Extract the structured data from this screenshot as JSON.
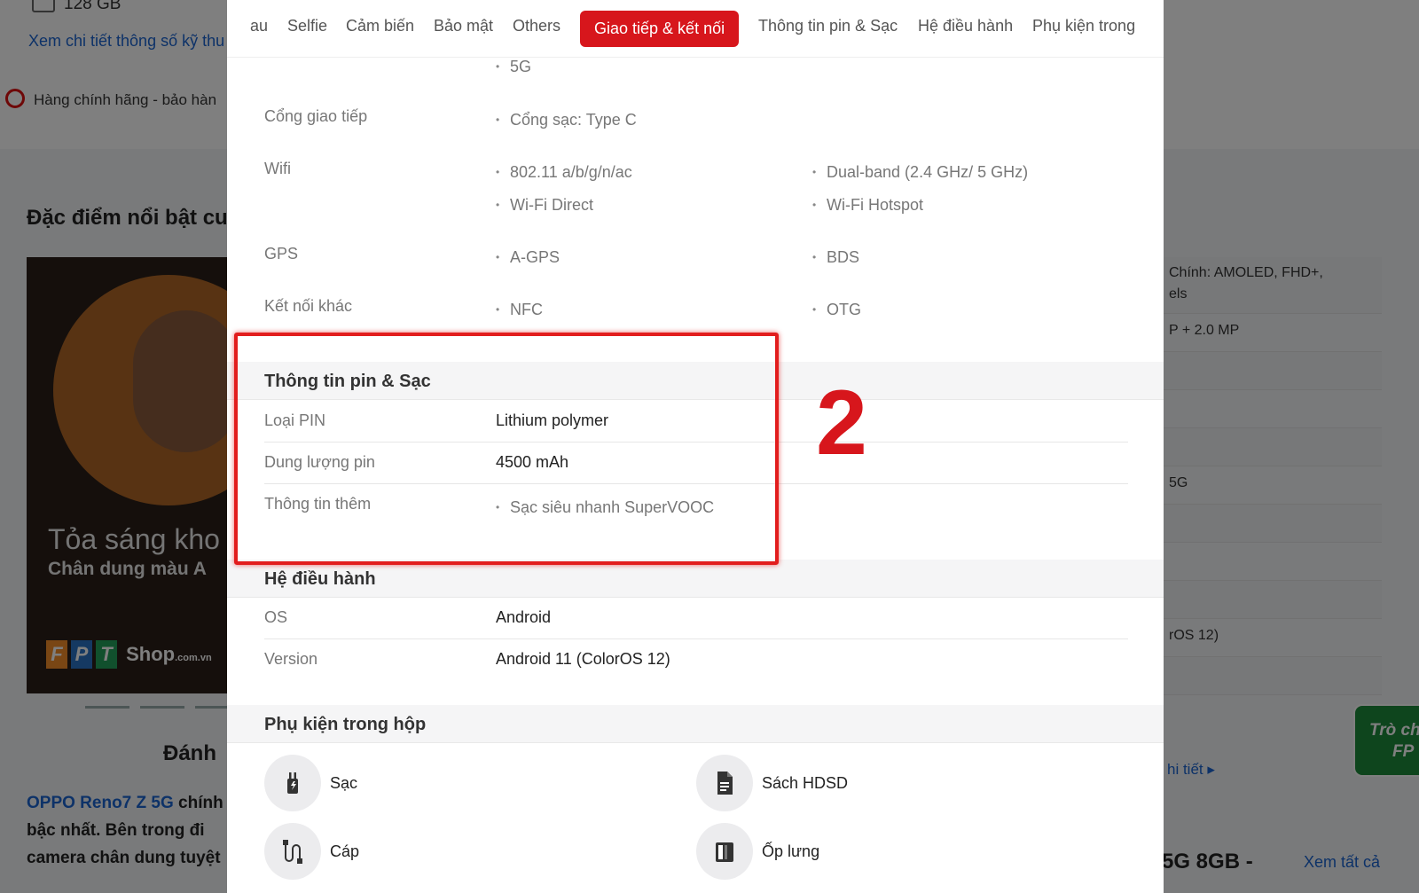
{
  "background": {
    "storage": "128 GB",
    "spec_link": "Xem chi tiết thông số kỹ thu",
    "genuine": "Hàng chính hãng - bảo hàn",
    "feature_title": "Đặc điểm nổi bật cu",
    "photo_caption_1": "Tỏa sáng kho",
    "photo_caption_2": "Chân dung màu A",
    "brand": "Shop",
    "brand_suffix": ".com.vn",
    "review_title": "Đánh",
    "article_link": "OPPO Reno7 Z 5G",
    "article_text_1": "chính",
    "article_text_2": "bậc nhất. Bên trong đi",
    "article_text_3": "camera chân dung tuyệt",
    "right_rows": [
      "Chính: AMOLED, FHD+,",
      "els",
      "P + 2.0 MP",
      "",
      "",
      "",
      "5G",
      "",
      "",
      "",
      "rOS 12)",
      ""
    ],
    "detail_link": "hi tiết",
    "bottom_title": "5G 8GB -",
    "see_all": "Xem tất cả",
    "game_badge_1": "Trò ch",
    "game_badge_2": "FP"
  },
  "tabs": [
    {
      "label": "au"
    },
    {
      "label": "Selfie"
    },
    {
      "label": "Cảm biến"
    },
    {
      "label": "Bảo mật"
    },
    {
      "label": "Others"
    },
    {
      "label": "Giao tiếp & kết nối",
      "active": true
    },
    {
      "label": "Thông tin pin & Sạc"
    },
    {
      "label": "Hệ điều hành"
    },
    {
      "label": "Phụ kiện trong"
    }
  ],
  "connectivity": {
    "top_value": "5G",
    "port_label": "Cổng giao tiếp",
    "port_value": "Cổng sạc: Type C",
    "wifi_label": "Wifi",
    "wifi_values": [
      "802.11 a/b/g/n/ac",
      "Dual-band (2.4 GHz/ 5 GHz)",
      "Wi-Fi Direct",
      "Wi-Fi Hotspot"
    ],
    "gps_label": "GPS",
    "gps_values": [
      "A-GPS",
      "BDS"
    ],
    "other_label": "Kết nối khác",
    "other_values": [
      "NFC",
      "OTG"
    ]
  },
  "battery": {
    "title": "Thông tin pin & Sạc",
    "type_label": "Loại PIN",
    "type_value": "Lithium polymer",
    "capacity_label": "Dung lượng pin",
    "capacity_value": "4500 mAh",
    "extra_label": "Thông tin thêm",
    "extra_value": "Sạc siêu nhanh SuperVOOC"
  },
  "os": {
    "title": "Hệ điều hành",
    "os_label": "OS",
    "os_value": "Android",
    "version_label": "Version",
    "version_value": "Android 11 (ColorOS 12)"
  },
  "accessories": {
    "title": "Phụ kiện trong hộp",
    "items": [
      {
        "label": "Sạc",
        "icon": "charger-icon"
      },
      {
        "label": "Sách HDSD",
        "icon": "manual-icon"
      },
      {
        "label": "Cáp",
        "icon": "cable-icon"
      },
      {
        "label": "Ốp lưng",
        "icon": "case-icon"
      }
    ]
  },
  "annotation": {
    "step_number": "2",
    "color": "#e21d1d"
  },
  "colors": {
    "accent": "#d7161c",
    "link": "#1b64d1"
  }
}
